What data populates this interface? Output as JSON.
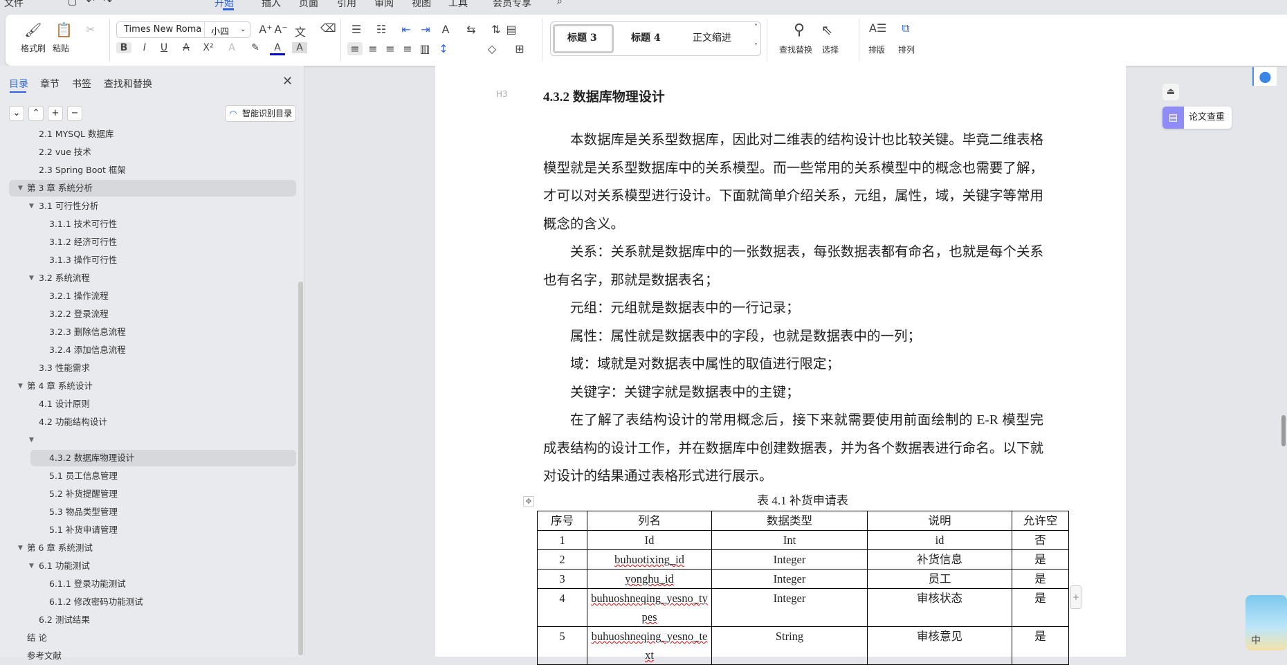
{
  "menu": {
    "items": [
      "文件",
      "开始",
      "插入",
      "页面",
      "引用",
      "审阅",
      "视图",
      "工具",
      "会员专享"
    ],
    "active": "开始"
  },
  "ribbon": {
    "format_painter": "格式刷",
    "paste": "粘贴",
    "font_name": "Times New Roma",
    "font_size": "小四",
    "styles": [
      "标题 3",
      "标题 4",
      "正文缩进"
    ],
    "find_replace": "查找替换",
    "select": "选择",
    "layout": "排版",
    "arrange": "排列"
  },
  "panel": {
    "tabs": [
      "目录",
      "章节",
      "书签",
      "查找和替换"
    ],
    "active_tab": "目录",
    "smart_toc": "智能识别目录",
    "toc": [
      {
        "label": "2.1 MYSQL 数据库",
        "level": 2,
        "arrow": false
      },
      {
        "label": "2.2 vue 技术",
        "level": 2,
        "arrow": false
      },
      {
        "label": "2.3 Spring Boot 框架",
        "level": 2,
        "arrow": false
      },
      {
        "label": "第 3 章  系统分析",
        "level": 1,
        "arrow": true,
        "highlight": true
      },
      {
        "label": "3.1  可行性分析",
        "level": 2,
        "arrow": true
      },
      {
        "label": "3.1.1  技术可行性",
        "level": 3,
        "arrow": false
      },
      {
        "label": "3.1.2  经济可行性",
        "level": 3,
        "arrow": false
      },
      {
        "label": "3.1.3  操作可行性",
        "level": 3,
        "arrow": false
      },
      {
        "label": "3.2  系统流程",
        "level": 2,
        "arrow": true
      },
      {
        "label": "3.2.1  操作流程",
        "level": 3,
        "arrow": false
      },
      {
        "label": "3.2.2  登录流程",
        "level": 3,
        "arrow": false
      },
      {
        "label": "3.2.3  删除信息流程",
        "level": 3,
        "arrow": false
      },
      {
        "label": "3.2.4  添加信息流程",
        "level": 3,
        "arrow": false
      },
      {
        "label": "3.3  性能需求",
        "level": 2,
        "arrow": false
      },
      {
        "label": "第 4 章  系统设计",
        "level": 1,
        "arrow": true
      },
      {
        "label": "4.1  设计原则",
        "level": 2,
        "arrow": false
      },
      {
        "label": "4.2  功能结构设计",
        "level": 2,
        "arrow": false
      },
      {
        "label": "",
        "level": 2,
        "arrow": true
      },
      {
        "label": "4.3.2  数据库物理设计",
        "level": 3,
        "arrow": false,
        "selected": true
      },
      {
        "label": "5.1 员工信息管理",
        "level": 3,
        "arrow": false
      },
      {
        "label": "5.2  补货提醒管理",
        "level": 3,
        "arrow": false
      },
      {
        "label": "5.3 物品类型管理",
        "level": 3,
        "arrow": false
      },
      {
        "label": "5.1 补货申请管理",
        "level": 3,
        "arrow": false
      },
      {
        "label": "第 6 章  系统测试",
        "level": 1,
        "arrow": true
      },
      {
        "label": "6.1  功能测试",
        "level": 2,
        "arrow": true
      },
      {
        "label": "6.1.1  登录功能测试",
        "level": 3,
        "arrow": false
      },
      {
        "label": "6.1.2  修改密码功能测试",
        "level": 3,
        "arrow": false
      },
      {
        "label": "6.2  测试结果",
        "level": 2,
        "arrow": false
      },
      {
        "label": "结    论",
        "level": 1,
        "arrow": false
      },
      {
        "label": "参考文献",
        "level": 1,
        "arrow": false
      }
    ]
  },
  "document": {
    "heading_marker": "H3",
    "heading": "4.3.2  数据库物理设计",
    "paragraphs": [
      "本数据库是关系型数据库，因此对二维表的结构设计也比较关键。毕竟二维表格模型就是关系型数据库中的关系模型。而一些常用的关系模型中的概念也需要了解，才可以对关系模型进行设计。下面就简单介绍关系，元组，属性，域，关键字等常用概念的含义。",
      "关系：关系就是数据库中的一张数据表，每张数据表都有命名，也就是每个关系也有名字，那就是数据表名；",
      "元组：元组就是数据表中的一行记录；",
      "属性：属性就是数据表中的字段，也就是数据表中的一列；",
      "域：域就是对数据表中属性的取值进行限定；",
      "关键字：关键字就是数据表中的主键；",
      "在了解了表结构设计的常用概念后，接下来就需要使用前面绘制的 E-R 模型完成表结构的设计工作，并在数据库中创建数据表，并为各个数据表进行命名。以下就对设计的结果通过表格形式进行展示。"
    ],
    "table_caption": "表 4.1 补货申请表",
    "table": {
      "headers": [
        "序号",
        "列名",
        "数据类型",
        "说明",
        "允许空"
      ],
      "rows": [
        [
          "1",
          "Id",
          "Int",
          "id",
          "否"
        ],
        [
          "2",
          "buhuotixing_id",
          "Integer",
          "补货信息",
          "是"
        ],
        [
          "3",
          "yonghu_id",
          "Integer",
          "员工",
          "是"
        ],
        [
          "4",
          "buhuoshneqing_yesno_types",
          "Integer",
          "审核状态",
          "是"
        ],
        [
          "5",
          "buhuoshneqing_yesno_text",
          "String",
          "审核意见",
          "是"
        ]
      ]
    }
  },
  "right": {
    "plagiarism_check": "论文查重",
    "ime": "中"
  },
  "colors": {
    "accent": "#2b62e3",
    "plagiarism": "#8f8cf5"
  }
}
